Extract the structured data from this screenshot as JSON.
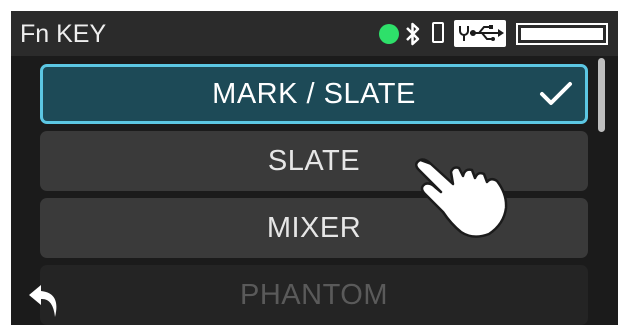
{
  "header": {
    "title": "Fn KEY",
    "status_dot_color": "#2ee06a",
    "icons": [
      "bluetooth-icon",
      "phone-icon",
      "usb-power-icon",
      "battery-icon"
    ]
  },
  "menu": {
    "items": [
      {
        "label": "MARK / SLATE",
        "selected": true
      },
      {
        "label": "SLATE",
        "selected": false
      },
      {
        "label": "MIXER",
        "selected": false
      },
      {
        "label": "PHANTOM",
        "selected": false
      }
    ],
    "selected_indicator": "check-icon"
  },
  "colors": {
    "selected_bg": "#1d4a57",
    "selected_border": "#5cc7e3",
    "item_bg": "#3a3a3a"
  },
  "overlay": {
    "pointer": "tap-hand-icon"
  },
  "nav": {
    "back": "back-arrow-icon"
  }
}
